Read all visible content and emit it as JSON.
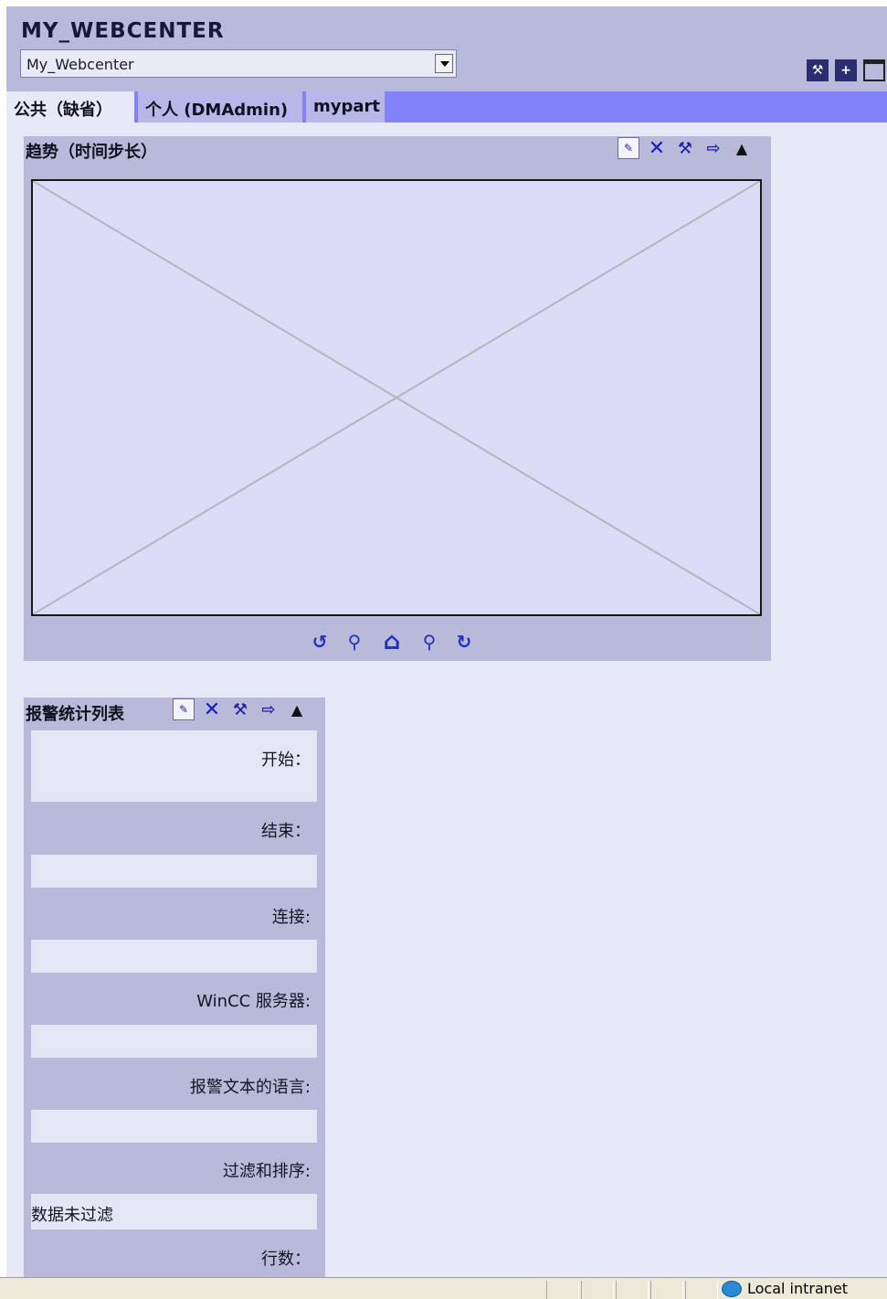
{
  "header": {
    "title": "MY_WEBCENTER",
    "view_select": {
      "selected": "My_Webcenter"
    },
    "icons": [
      "configure-icon",
      "add-icon",
      "window-icon"
    ]
  },
  "tabs": [
    {
      "label": "公共（缺省）",
      "active": true
    },
    {
      "label": "个人 (DMAdmin)",
      "active": false
    },
    {
      "label": "mypart",
      "active": false
    }
  ],
  "trend_panel": {
    "title": "趋势（时间步长）",
    "tools": [
      "edit-icon",
      "close-icon",
      "settings-icon",
      "export-icon",
      "collapse-icon"
    ],
    "nav_icons": [
      "back-in-time-icon",
      "zoom-out-icon",
      "home-icon",
      "zoom-in-icon",
      "forward-in-time-icon"
    ]
  },
  "alarm_panel": {
    "title": "报警统计列表",
    "tools": [
      "edit-icon",
      "close-icon",
      "settings-icon",
      "export-icon",
      "collapse-icon"
    ],
    "fields": [
      {
        "label": "开始：",
        "value": ""
      },
      {
        "label": "结束：",
        "value": ""
      },
      {
        "label": "连接:",
        "value": ""
      },
      {
        "label": "WinCC 服务器:",
        "value": ""
      },
      {
        "label": "报警文本的语言:",
        "value": ""
      },
      {
        "label": "过滤和排序:",
        "value": "数据未过滤"
      },
      {
        "label": "行数：",
        "value": ""
      }
    ]
  },
  "status_bar": {
    "zone": "Local intranet"
  },
  "colors": {
    "header_bg": "#b9badb",
    "tabbar_bg": "#8183f6",
    "page_bg": "#e8e9f8",
    "panel_bg": "#b9bad9"
  }
}
